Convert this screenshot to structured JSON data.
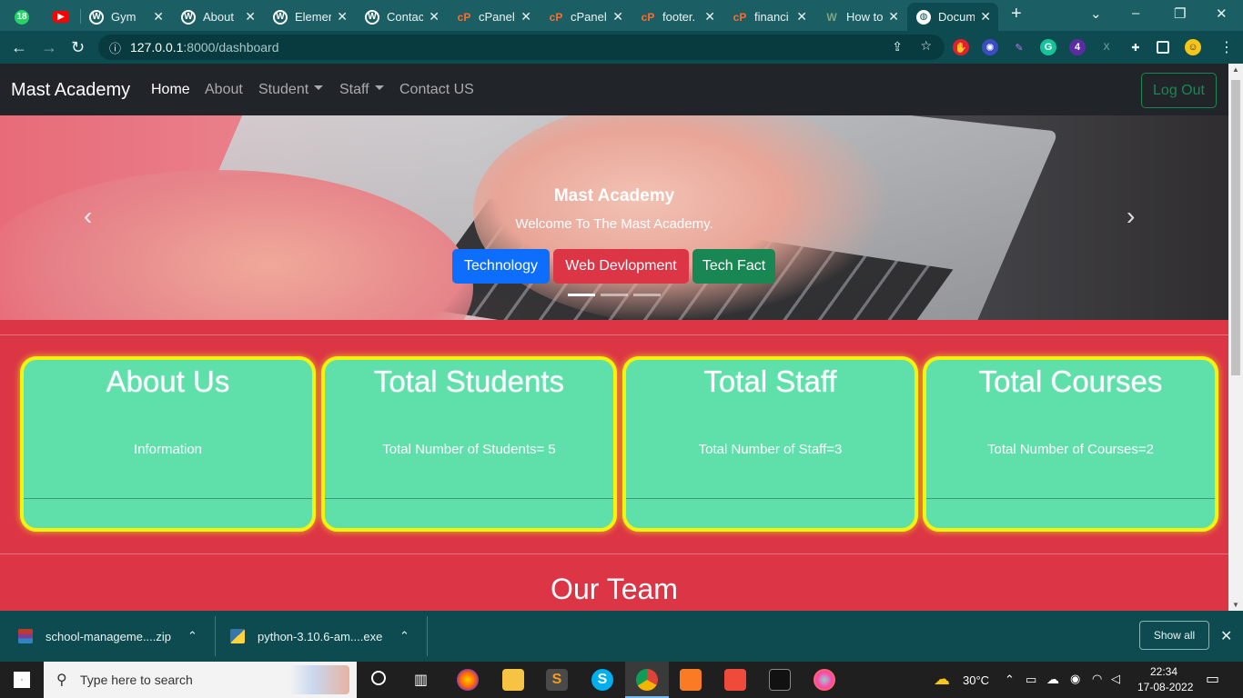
{
  "browser": {
    "tabs": [
      {
        "title": "",
        "badge": "18",
        "icon": "whatsapp-icon",
        "color": "#25d366"
      },
      {
        "title": "",
        "icon": "youtube-icon",
        "color": "#ff0000"
      },
      {
        "title": "Gym",
        "icon": "wordpress-icon",
        "color": "#ffffff"
      },
      {
        "title": "About",
        "icon": "wordpress-icon",
        "color": "#ffffff"
      },
      {
        "title": "Elemer",
        "icon": "wordpress-icon",
        "color": "#ffffff"
      },
      {
        "title": "Contac",
        "icon": "wordpress-icon",
        "color": "#ffffff"
      },
      {
        "title": "cPanel",
        "icon": "cpanel-icon",
        "color": "#ff6c2c"
      },
      {
        "title": "cPanel",
        "icon": "cpanel-icon",
        "color": "#ff6c2c"
      },
      {
        "title": "footer.",
        "icon": "cpanel-icon",
        "color": "#ff6c2c"
      },
      {
        "title": "financi",
        "icon": "cpanel-icon",
        "color": "#ff6c2c"
      },
      {
        "title": "How to",
        "icon": "wikihow-icon",
        "color": "#3a6b3c"
      },
      {
        "title": "Docum",
        "icon": "globe-icon",
        "color": "#ffffff",
        "active": true
      }
    ],
    "url": "127.0.0.1:8000/dashboard",
    "url_host": "127.0.0.1",
    "url_rest": ":8000/dashboard",
    "new_tab": "+"
  },
  "navbar": {
    "brand": "Mast Academy",
    "links": [
      "Home",
      "About",
      "Student",
      "Staff",
      "Contact US"
    ],
    "logout": "Log Out"
  },
  "carousel": {
    "title": "Mast Academy",
    "subtitle": "Welcome To The Mast Academy.",
    "buttons": [
      {
        "label": "Technology",
        "color": "#0d6efd"
      },
      {
        "label": "Web Devlopment",
        "color": "#dc3545"
      },
      {
        "label": "Tech Fact",
        "color": "#198754"
      }
    ],
    "prev": "‹",
    "next": "›"
  },
  "cards": [
    {
      "title": "About Us",
      "text": "Information"
    },
    {
      "title": "Total Students",
      "text": "Total Number of Students= 5"
    },
    {
      "title": "Total Staff",
      "text": "Total Number of Staff=3"
    },
    {
      "title": "Total Courses",
      "text": "Total Number of Courses=2"
    }
  ],
  "team_title": "Our Team",
  "downloads": {
    "items": [
      "school-manageme....zip",
      "python-3.10.6-am....exe"
    ],
    "show_all": "Show all",
    "close": "✕"
  },
  "taskbar": {
    "search_placeholder": "Type here to search",
    "weather": "30°C",
    "time": "22:34",
    "date": "17-08-2022"
  },
  "colors": {
    "page_bg": "#dc3545",
    "card_bg": "#5fe0ab",
    "card_border": "#f4f40a",
    "navbar_bg": "#212529",
    "logout": "#198754"
  }
}
